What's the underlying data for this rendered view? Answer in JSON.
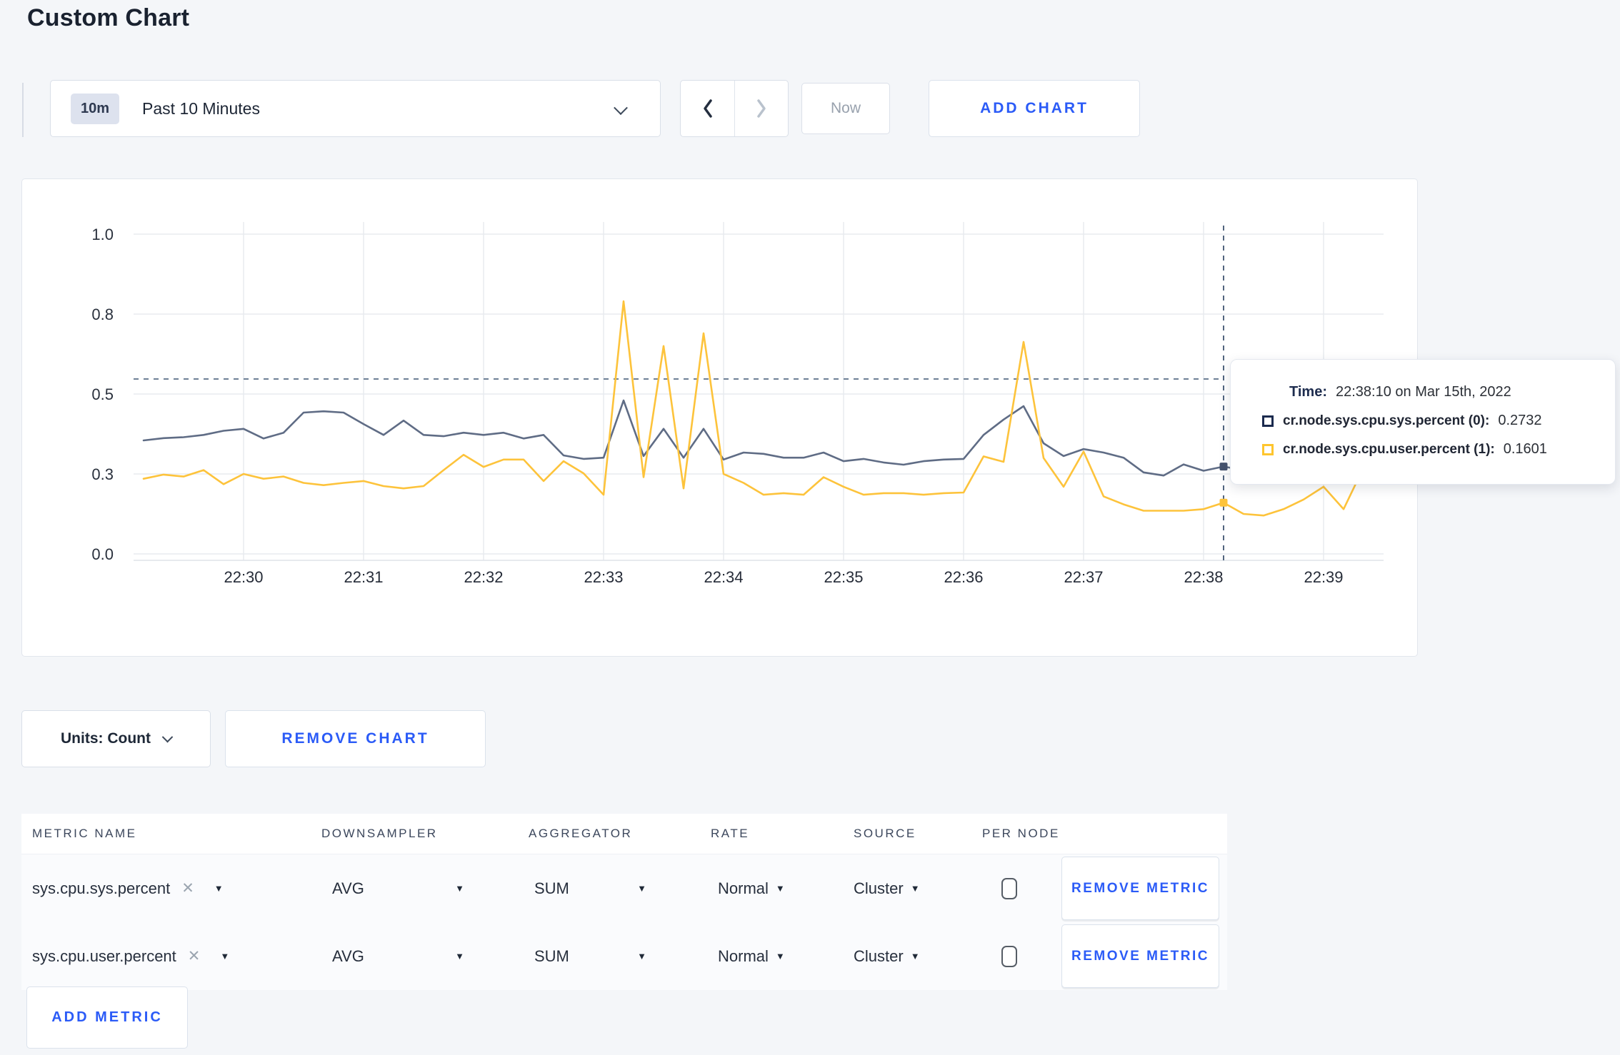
{
  "page": {
    "title": "Custom Chart",
    "background": "#f4f6f9",
    "accent_blue": "#2b5bf7"
  },
  "toolbar": {
    "time_range": {
      "badge": "10m",
      "label": "Past 10 Minutes"
    },
    "now_label": "Now",
    "add_chart_label": "ADD CHART"
  },
  "chart_data": {
    "type": "line",
    "title": "",
    "grid": true,
    "legend_position": "tooltip",
    "x_domain": [
      "22:29:05",
      "22:39:30"
    ],
    "x_gridlines": [
      "22:30",
      "22:31",
      "22:32",
      "22:33",
      "22:34",
      "22:35",
      "22:36",
      "22:37",
      "22:38",
      "22:39"
    ],
    "x_tick_labels": [
      "22:30",
      "22:31",
      "22:32",
      "22:33",
      "22:34",
      "22:35",
      "22:36",
      "22:37",
      "22:38",
      "22:39"
    ],
    "y_domain": [
      0,
      1
    ],
    "y_ticks": [
      {
        "value": 0,
        "label": "0.0"
      },
      {
        "value": 0.25,
        "label": "0.3"
      },
      {
        "value": 0.5,
        "label": "0.5"
      },
      {
        "value": 0.75,
        "label": "0.8"
      },
      {
        "value": 1,
        "label": "1.0"
      }
    ],
    "times": [
      "22:29:10",
      "22:29:20",
      "22:29:30",
      "22:29:40",
      "22:29:50",
      "22:30:00",
      "22:30:10",
      "22:30:20",
      "22:30:30",
      "22:30:40",
      "22:30:50",
      "22:31:00",
      "22:31:10",
      "22:31:20",
      "22:31:30",
      "22:31:40",
      "22:31:50",
      "22:32:00",
      "22:32:10",
      "22:32:20",
      "22:32:30",
      "22:32:40",
      "22:32:50",
      "22:33:00",
      "22:33:10",
      "22:33:20",
      "22:33:30",
      "22:33:40",
      "22:33:50",
      "22:34:00",
      "22:34:10",
      "22:34:20",
      "22:34:30",
      "22:34:40",
      "22:34:50",
      "22:35:00",
      "22:35:10",
      "22:35:20",
      "22:35:30",
      "22:35:40",
      "22:35:50",
      "22:36:00",
      "22:36:10",
      "22:36:20",
      "22:36:30",
      "22:36:40",
      "22:36:50",
      "22:37:00",
      "22:37:10",
      "22:37:20",
      "22:37:30",
      "22:37:40",
      "22:37:50",
      "22:38:00",
      "22:38:10",
      "22:38:20",
      "22:38:30",
      "22:38:40",
      "22:38:50",
      "22:39:00",
      "22:39:10",
      "22:39:20"
    ],
    "series": [
      {
        "name": "cr.node.sys.cpu.sys.percent",
        "color": "#5f6c85",
        "dot_color": "#46536e",
        "values": [
          0.355,
          0.362,
          0.365,
          0.372,
          0.385,
          0.391,
          0.361,
          0.379,
          0.442,
          0.446,
          0.442,
          0.406,
          0.372,
          0.417,
          0.372,
          0.368,
          0.379,
          0.372,
          0.379,
          0.361,
          0.372,
          0.308,
          0.297,
          0.301,
          0.48,
          0.306,
          0.391,
          0.301,
          0.391,
          0.295,
          0.317,
          0.313,
          0.301,
          0.301,
          0.317,
          0.29,
          0.297,
          0.286,
          0.279,
          0.29,
          0.295,
          0.297,
          0.372,
          0.42,
          0.462,
          0.346,
          0.306,
          0.328,
          0.317,
          0.301,
          0.255,
          0.245,
          0.28,
          0.26,
          0.2732,
          0.262,
          0.27,
          0.29,
          0.3,
          0.295,
          0.285,
          0.29
        ]
      },
      {
        "name": "cr.node.sys.cpu.user.percent",
        "color": "#fdc33b",
        "dot_color": "#fdc33b",
        "values": [
          0.235,
          0.248,
          0.242,
          0.262,
          0.218,
          0.25,
          0.235,
          0.242,
          0.222,
          0.215,
          0.222,
          0.228,
          0.212,
          0.205,
          0.212,
          0.262,
          0.31,
          0.272,
          0.295,
          0.295,
          0.228,
          0.29,
          0.252,
          0.185,
          0.79,
          0.24,
          0.65,
          0.205,
          0.69,
          0.25,
          0.222,
          0.185,
          0.19,
          0.185,
          0.24,
          0.21,
          0.185,
          0.19,
          0.19,
          0.185,
          0.19,
          0.192,
          0.305,
          0.288,
          0.663,
          0.3,
          0.21,
          0.32,
          0.18,
          0.155,
          0.135,
          0.135,
          0.135,
          0.14,
          0.1601,
          0.125,
          0.12,
          0.14,
          0.17,
          0.21,
          0.14,
          0.27
        ]
      }
    ],
    "crosshair": {
      "time": "22:38:10",
      "h_line_value": 0.547,
      "points": [
        {
          "series": 0,
          "value": 0.2732
        },
        {
          "series": 1,
          "value": 0.1601
        }
      ]
    }
  },
  "tooltip": {
    "time_label": "Time:",
    "time_value": "22:38:10 on Mar 15th, 2022",
    "rows": [
      {
        "name": "cr.node.sys.cpu.sys.percent (0):",
        "value": "0.2732",
        "color": "#1b2a4e"
      },
      {
        "name": "cr.node.sys.cpu.user.percent (1):",
        "value": "0.1601",
        "color": "#fec52e"
      }
    ]
  },
  "units_row": {
    "units_label": "Units: Count",
    "remove_chart_label": "REMOVE CHART"
  },
  "metrics_table": {
    "headers": [
      "METRIC NAME",
      "DOWNSAMPLER",
      "AGGREGATOR",
      "RATE",
      "SOURCE",
      "PER NODE"
    ],
    "remove_metric_label": "REMOVE METRIC",
    "add_metric_label": "ADD METRIC",
    "close_glyph": "✕",
    "caret_glyph": "▼",
    "rows": [
      {
        "name": "sys.cpu.sys.percent",
        "downsampler": "AVG",
        "aggregator": "SUM",
        "rate": "Normal",
        "source": "Cluster",
        "per_node_checked": false
      },
      {
        "name": "sys.cpu.user.percent",
        "downsampler": "AVG",
        "aggregator": "SUM",
        "rate": "Normal",
        "source": "Cluster",
        "per_node_checked": false
      }
    ]
  }
}
